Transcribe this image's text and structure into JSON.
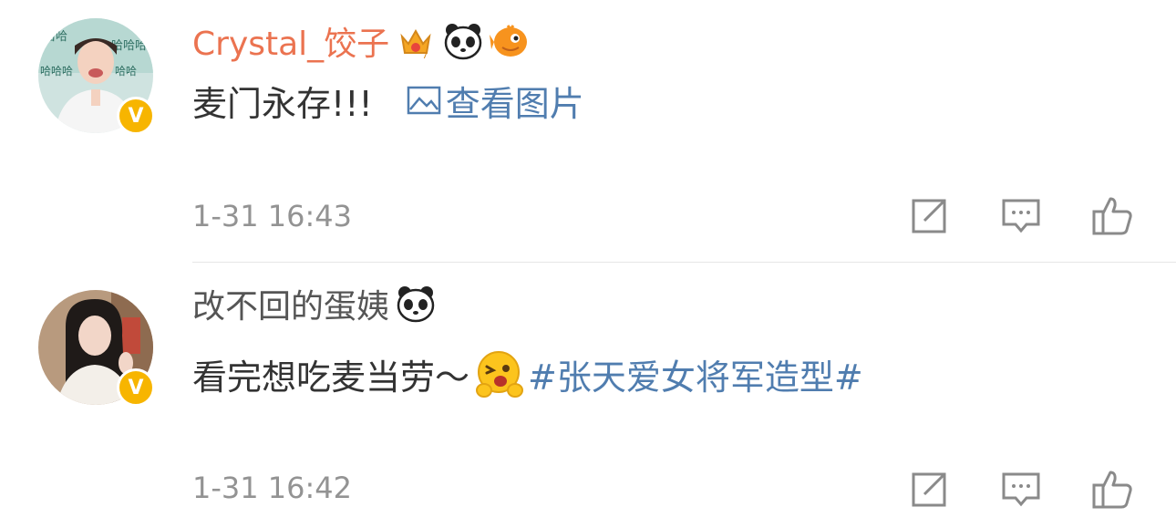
{
  "comments": [
    {
      "username": "Crystal_饺子",
      "badges": [
        "crown-vip-icon",
        "panda-icon",
        "fish-icon"
      ],
      "verified_badge": "V",
      "text": "麦门永存!!!",
      "image_link_label": "查看图片",
      "image_link_icon": "image-icon",
      "time": "1-31 16:43",
      "accent": "#eb7350"
    },
    {
      "username": "改不回的蛋姨",
      "badges": [
        "panda-icon"
      ],
      "verified_badge": "V",
      "text": "看完想吃麦当劳～",
      "emoji": "wink-emoji-icon",
      "topic_link": "#张天爱女将军造型#",
      "time": "1-31 16:42",
      "accent": "#555555"
    }
  ],
  "actions": {
    "share_icon": "share-icon",
    "comment_icon": "comment-icon",
    "like_icon": "like-icon"
  },
  "colors": {
    "link": "#507daf",
    "time": "#939393",
    "text": "#333333",
    "verified": "#f7b500",
    "divider": "#e6e6e6"
  }
}
